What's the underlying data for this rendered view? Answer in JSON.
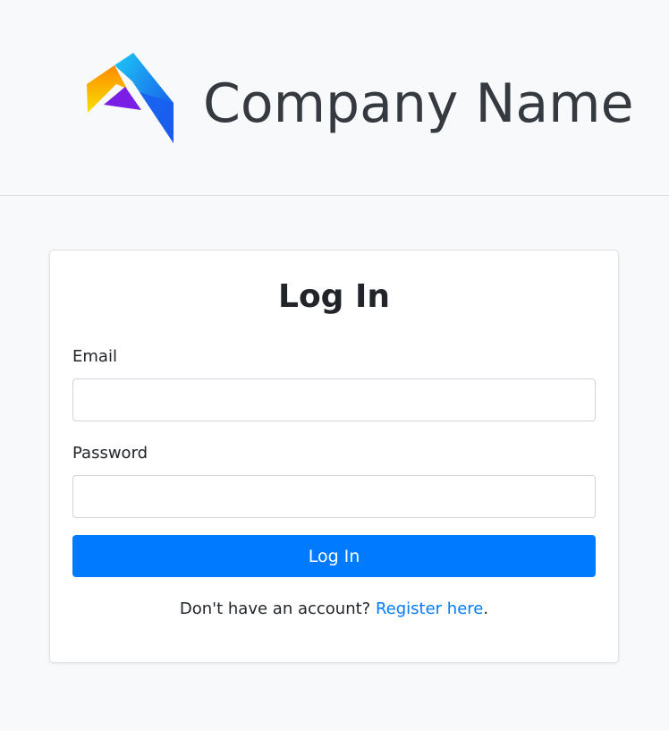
{
  "header": {
    "logo_icon": "company-logo-icon",
    "company_name": "Company Name"
  },
  "login_form": {
    "title": "Log In",
    "email_label": "Email",
    "email_value": "",
    "password_label": "Password",
    "password_value": "",
    "submit_label": "Log In",
    "register_prompt": "Don't have an account?",
    "register_link_text": "Register here",
    "register_suffix": "."
  },
  "colors": {
    "background": "#f8f9fa",
    "primary": "#007bff",
    "card": "#ffffff",
    "text": "#212529",
    "company_name": "#343a40"
  }
}
